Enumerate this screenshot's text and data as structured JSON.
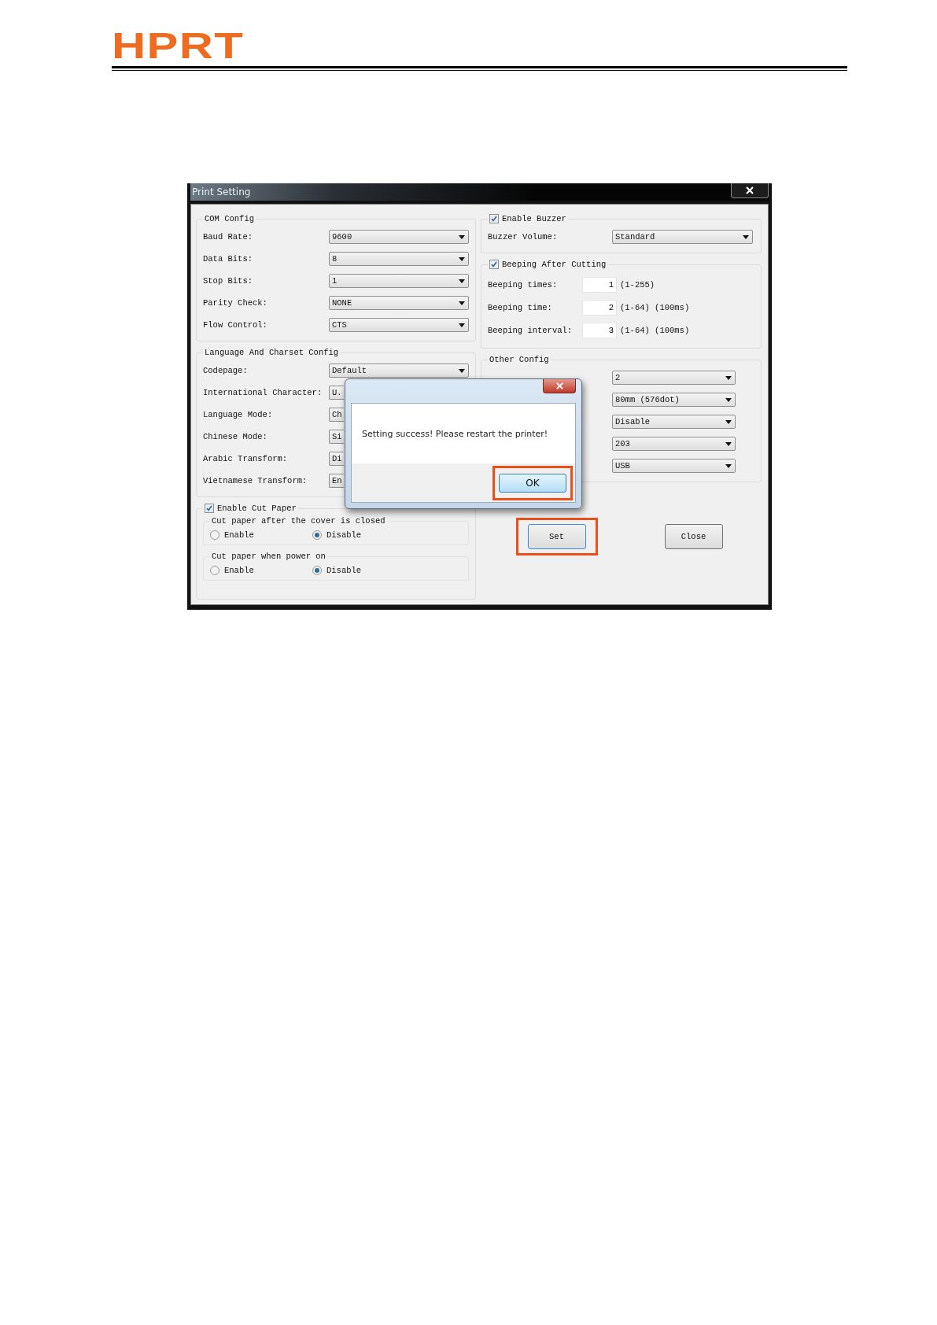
{
  "logo": {
    "text": "HPRT"
  },
  "dialog": {
    "title": "Print Setting",
    "com_config": {
      "title": "COM Config",
      "fields": [
        {
          "label": "Baud Rate:",
          "value": "9600"
        },
        {
          "label": "Data Bits:",
          "value": "8"
        },
        {
          "label": "Stop Bits:",
          "value": "1"
        },
        {
          "label": "Parity Check:",
          "value": "NONE"
        },
        {
          "label": "Flow Control:",
          "value": "CTS"
        }
      ]
    },
    "language_config": {
      "title": "Language And Charset Config",
      "fields": [
        {
          "label": "Codepage:",
          "value": "Default",
          "kind": "full"
        },
        {
          "label": "International Character:",
          "value": "U.",
          "kind": "covered"
        },
        {
          "label": "Language Mode:",
          "value": "Ch",
          "kind": "covered"
        },
        {
          "label": "Chinese Mode:",
          "value": "Si",
          "kind": "covered"
        },
        {
          "label": "Arabic Transform:",
          "value": "Di",
          "kind": "covered"
        },
        {
          "label": "Vietnamese Transform:",
          "value": "En",
          "kind": "covered"
        }
      ]
    },
    "cut_paper": {
      "label": "Enable Cut Paper",
      "checked": true,
      "groups": [
        {
          "title": "Cut paper after the cover is closed",
          "options": [
            {
              "label": "Enable",
              "selected": false
            },
            {
              "label": "Disable",
              "selected": true
            }
          ]
        },
        {
          "title": "Cut paper when power on",
          "options": [
            {
              "label": "Enable",
              "selected": false
            },
            {
              "label": "Disable",
              "selected": true
            }
          ]
        }
      ]
    },
    "buzzer": {
      "label": "Enable Buzzer",
      "checked": true,
      "volume_label": "Buzzer Volume:",
      "volume": "Standard"
    },
    "beeping": {
      "label": "Beeping After Cutting",
      "checked": true,
      "fields": [
        {
          "label": "Beeping times:",
          "value": "1",
          "range": "(1-255)"
        },
        {
          "label": "Beeping time:",
          "value": "2",
          "range": "(1-64) (100ms)"
        },
        {
          "label": "Beeping interval:",
          "value": "3",
          "range": "(1-64) (100ms)"
        }
      ]
    },
    "other_config": {
      "title": "Other Config",
      "values": [
        "2",
        "80mm (576dot)",
        "Disable",
        "203",
        "USB"
      ]
    },
    "buttons": [
      {
        "label": "Set",
        "highlighted": true
      },
      {
        "label": "Close",
        "highlighted": false
      }
    ]
  },
  "message_box": {
    "message": "Setting success! Please restart the printer!",
    "button": {
      "label": "OK",
      "highlighted": true
    }
  }
}
